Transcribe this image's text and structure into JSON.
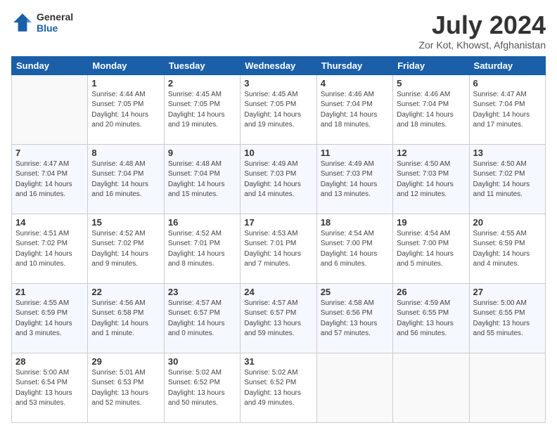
{
  "header": {
    "logo_line1": "General",
    "logo_line2": "Blue",
    "title": "July 2024",
    "subtitle": "Zor Kot, Khowst, Afghanistan"
  },
  "days_of_week": [
    "Sunday",
    "Monday",
    "Tuesday",
    "Wednesday",
    "Thursday",
    "Friday",
    "Saturday"
  ],
  "weeks": [
    [
      {
        "day": "",
        "info": ""
      },
      {
        "day": "1",
        "info": "Sunrise: 4:44 AM\nSunset: 7:05 PM\nDaylight: 14 hours\nand 20 minutes."
      },
      {
        "day": "2",
        "info": "Sunrise: 4:45 AM\nSunset: 7:05 PM\nDaylight: 14 hours\nand 19 minutes."
      },
      {
        "day": "3",
        "info": "Sunrise: 4:45 AM\nSunset: 7:05 PM\nDaylight: 14 hours\nand 19 minutes."
      },
      {
        "day": "4",
        "info": "Sunrise: 4:46 AM\nSunset: 7:04 PM\nDaylight: 14 hours\nand 18 minutes."
      },
      {
        "day": "5",
        "info": "Sunrise: 4:46 AM\nSunset: 7:04 PM\nDaylight: 14 hours\nand 18 minutes."
      },
      {
        "day": "6",
        "info": "Sunrise: 4:47 AM\nSunset: 7:04 PM\nDaylight: 14 hours\nand 17 minutes."
      }
    ],
    [
      {
        "day": "7",
        "info": "Sunrise: 4:47 AM\nSunset: 7:04 PM\nDaylight: 14 hours\nand 16 minutes."
      },
      {
        "day": "8",
        "info": "Sunrise: 4:48 AM\nSunset: 7:04 PM\nDaylight: 14 hours\nand 16 minutes."
      },
      {
        "day": "9",
        "info": "Sunrise: 4:48 AM\nSunset: 7:04 PM\nDaylight: 14 hours\nand 15 minutes."
      },
      {
        "day": "10",
        "info": "Sunrise: 4:49 AM\nSunset: 7:03 PM\nDaylight: 14 hours\nand 14 minutes."
      },
      {
        "day": "11",
        "info": "Sunrise: 4:49 AM\nSunset: 7:03 PM\nDaylight: 14 hours\nand 13 minutes."
      },
      {
        "day": "12",
        "info": "Sunrise: 4:50 AM\nSunset: 7:03 PM\nDaylight: 14 hours\nand 12 minutes."
      },
      {
        "day": "13",
        "info": "Sunrise: 4:50 AM\nSunset: 7:02 PM\nDaylight: 14 hours\nand 11 minutes."
      }
    ],
    [
      {
        "day": "14",
        "info": "Sunrise: 4:51 AM\nSunset: 7:02 PM\nDaylight: 14 hours\nand 10 minutes."
      },
      {
        "day": "15",
        "info": "Sunrise: 4:52 AM\nSunset: 7:02 PM\nDaylight: 14 hours\nand 9 minutes."
      },
      {
        "day": "16",
        "info": "Sunrise: 4:52 AM\nSunset: 7:01 PM\nDaylight: 14 hours\nand 8 minutes."
      },
      {
        "day": "17",
        "info": "Sunrise: 4:53 AM\nSunset: 7:01 PM\nDaylight: 14 hours\nand 7 minutes."
      },
      {
        "day": "18",
        "info": "Sunrise: 4:54 AM\nSunset: 7:00 PM\nDaylight: 14 hours\nand 6 minutes."
      },
      {
        "day": "19",
        "info": "Sunrise: 4:54 AM\nSunset: 7:00 PM\nDaylight: 14 hours\nand 5 minutes."
      },
      {
        "day": "20",
        "info": "Sunrise: 4:55 AM\nSunset: 6:59 PM\nDaylight: 14 hours\nand 4 minutes."
      }
    ],
    [
      {
        "day": "21",
        "info": "Sunrise: 4:55 AM\nSunset: 6:59 PM\nDaylight: 14 hours\nand 3 minutes."
      },
      {
        "day": "22",
        "info": "Sunrise: 4:56 AM\nSunset: 6:58 PM\nDaylight: 14 hours\nand 1 minute."
      },
      {
        "day": "23",
        "info": "Sunrise: 4:57 AM\nSunset: 6:57 PM\nDaylight: 14 hours\nand 0 minutes."
      },
      {
        "day": "24",
        "info": "Sunrise: 4:57 AM\nSunset: 6:57 PM\nDaylight: 13 hours\nand 59 minutes."
      },
      {
        "day": "25",
        "info": "Sunrise: 4:58 AM\nSunset: 6:56 PM\nDaylight: 13 hours\nand 57 minutes."
      },
      {
        "day": "26",
        "info": "Sunrise: 4:59 AM\nSunset: 6:55 PM\nDaylight: 13 hours\nand 56 minutes."
      },
      {
        "day": "27",
        "info": "Sunrise: 5:00 AM\nSunset: 6:55 PM\nDaylight: 13 hours\nand 55 minutes."
      }
    ],
    [
      {
        "day": "28",
        "info": "Sunrise: 5:00 AM\nSunset: 6:54 PM\nDaylight: 13 hours\nand 53 minutes."
      },
      {
        "day": "29",
        "info": "Sunrise: 5:01 AM\nSunset: 6:53 PM\nDaylight: 13 hours\nand 52 minutes."
      },
      {
        "day": "30",
        "info": "Sunrise: 5:02 AM\nSunset: 6:52 PM\nDaylight: 13 hours\nand 50 minutes."
      },
      {
        "day": "31",
        "info": "Sunrise: 5:02 AM\nSunset: 6:52 PM\nDaylight: 13 hours\nand 49 minutes."
      },
      {
        "day": "",
        "info": ""
      },
      {
        "day": "",
        "info": ""
      },
      {
        "day": "",
        "info": ""
      }
    ]
  ]
}
